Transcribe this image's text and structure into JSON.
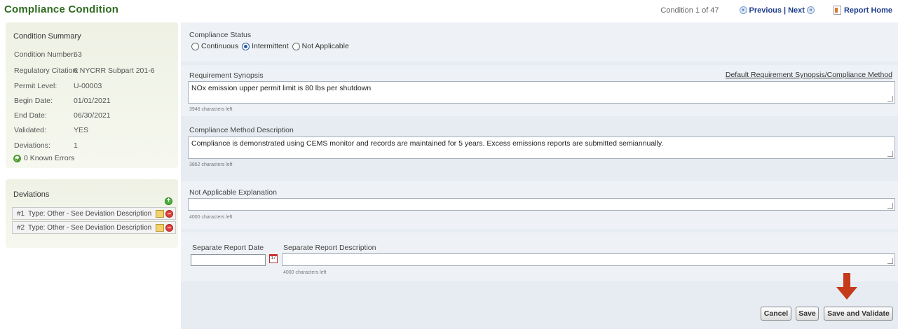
{
  "header": {
    "title": "Compliance Condition",
    "counter": "Condition 1 of 47",
    "prev_label": "Previous",
    "separator": "|",
    "next_label": "Next",
    "home_label": "Report Home"
  },
  "summary": {
    "title": "Condition Summary",
    "rows": [
      {
        "label": "Condition Number:",
        "value": "63"
      },
      {
        "label": "Regulatory Citation:",
        "value": "6 NYCRR Subpart 201-6"
      },
      {
        "label": "Permit Level:",
        "value": "U-00003"
      },
      {
        "label": "Begin Date:",
        "value": "01/01/2021"
      },
      {
        "label": "End Date:",
        "value": "06/30/2021"
      },
      {
        "label": "Validated:",
        "value": "YES"
      },
      {
        "label": "Deviations:",
        "value": "1"
      }
    ],
    "errors": "0 Known Errors"
  },
  "deviations": {
    "title": "Deviations",
    "items": [
      {
        "num": "#1",
        "text": "Type: Other - See Deviation Description"
      },
      {
        "num": "#2",
        "text": "Type: Other - See Deviation Description"
      }
    ]
  },
  "compliance_status": {
    "label": "Compliance Status",
    "options": [
      "Continuous",
      "Intermittent",
      "Not Applicable"
    ],
    "selected": "Intermittent"
  },
  "requirement": {
    "label": "Requirement Synopsis",
    "link": "Default Requirement Synopsis/Compliance Method",
    "value": "NOx emission upper permit limit is 80 lbs per shutdown",
    "chars_left": "3946 characters left"
  },
  "method": {
    "label": "Compliance Method Description",
    "value": "Compliance is demonstrated using CEMS monitor and records are maintained for 5 years. Excess emissions reports are submitted semiannually.",
    "chars_left": "3862 characters left"
  },
  "na_explanation": {
    "label": "Not Applicable Explanation",
    "value": "",
    "chars_left": "4000 characters left"
  },
  "separate_report": {
    "date_label": "Separate Report Date",
    "date_value": "",
    "calendar_text": "17",
    "desc_label": "Separate Report Description",
    "desc_value": "",
    "chars_left": "4000 characters left"
  },
  "actions": {
    "cancel": "Cancel",
    "save": "Save",
    "save_validate": "Save and Validate"
  },
  "colors": {
    "title_green": "#2e6b1f",
    "panel_bg": "#eef1e4",
    "main_bg": "#e6ecf2",
    "arrow": "#c53a1a"
  }
}
